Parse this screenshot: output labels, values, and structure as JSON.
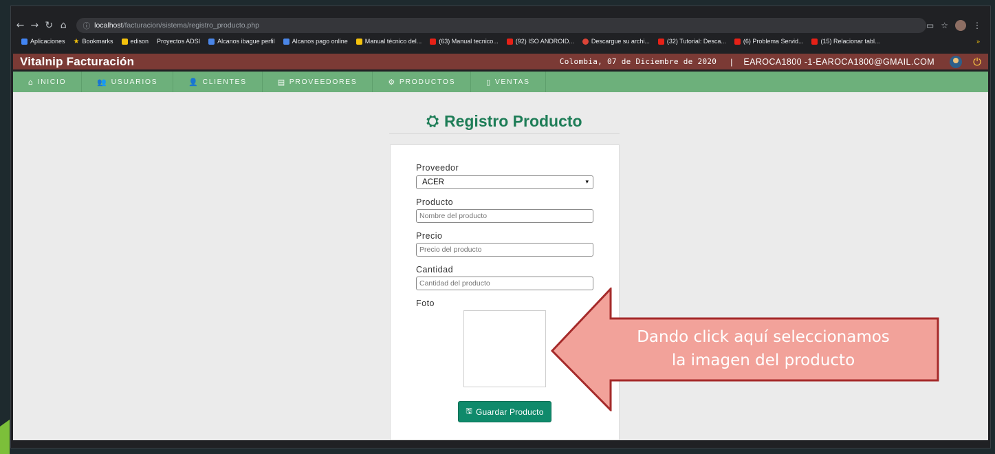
{
  "browser": {
    "url_host": "localhost",
    "url_path": "/facturacion/sistema/registro_producto.php",
    "bookmarks": [
      {
        "label": "Aplicaciones",
        "icon": "apps-grid-icon"
      },
      {
        "label": "Bookmarks",
        "icon": "star-icon"
      },
      {
        "label": "edison",
        "icon": "folder-icon"
      },
      {
        "label": "Proyectos ADSI",
        "icon": ""
      },
      {
        "label": "Alcanos ibague perfil",
        "icon": "alcanos-icon"
      },
      {
        "label": "Alcanos pago online",
        "icon": "alcanos-icon"
      },
      {
        "label": "Manual técnico del...",
        "icon": "page-icon"
      },
      {
        "label": "(63) Manual tecnico...",
        "icon": "youtube-icon"
      },
      {
        "label": "(92) ISO ANDROID...",
        "icon": "youtube-icon"
      },
      {
        "label": "Descargue su archi...",
        "icon": "opera-icon"
      },
      {
        "label": "(32) Tutorial: Desca...",
        "icon": "youtube-icon"
      },
      {
        "label": "(6) Problema Servid...",
        "icon": "youtube-icon"
      },
      {
        "label": "(15) Relacionar tabl...",
        "icon": "youtube-icon"
      }
    ],
    "more": "»"
  },
  "header": {
    "title": "Vitalnip Facturación",
    "date": "Colombia, 07 de Diciembre de 2020",
    "separator": "|",
    "user": "EAROCA1800 -1-EAROCA1800@GMAIL.COM"
  },
  "nav": [
    {
      "label": "INICIO",
      "icon": "home-icon",
      "glyph": "⌂"
    },
    {
      "label": "USUARIOS",
      "icon": "users-icon",
      "glyph": "👥"
    },
    {
      "label": "CLIENTES",
      "icon": "user-icon",
      "glyph": "👤"
    },
    {
      "label": "PROVEEDORES",
      "icon": "building-icon",
      "glyph": "▤"
    },
    {
      "label": "PRODUCTOS",
      "icon": "cubes-icon",
      "glyph": "⚙"
    },
    {
      "label": "VENTAS",
      "icon": "file-icon",
      "glyph": "▯"
    }
  ],
  "page": {
    "heading": "Registro Producto"
  },
  "form": {
    "proveedor_label": "Proveedor",
    "proveedor_selected": "ACER",
    "producto_label": "Producto",
    "producto_placeholder": "Nombre del producto",
    "precio_label": "Precio",
    "precio_placeholder": "Precio del producto",
    "cantidad_label": "Cantidad",
    "cantidad_placeholder": "Cantidad del producto",
    "foto_label": "Foto",
    "save_label": "Guardar Producto"
  },
  "callout": {
    "line1": "Dando click aquí seleccionamos",
    "line2": "la imagen del producto",
    "fill_color": "#f2a29a",
    "border_color": "#a52a2a"
  }
}
